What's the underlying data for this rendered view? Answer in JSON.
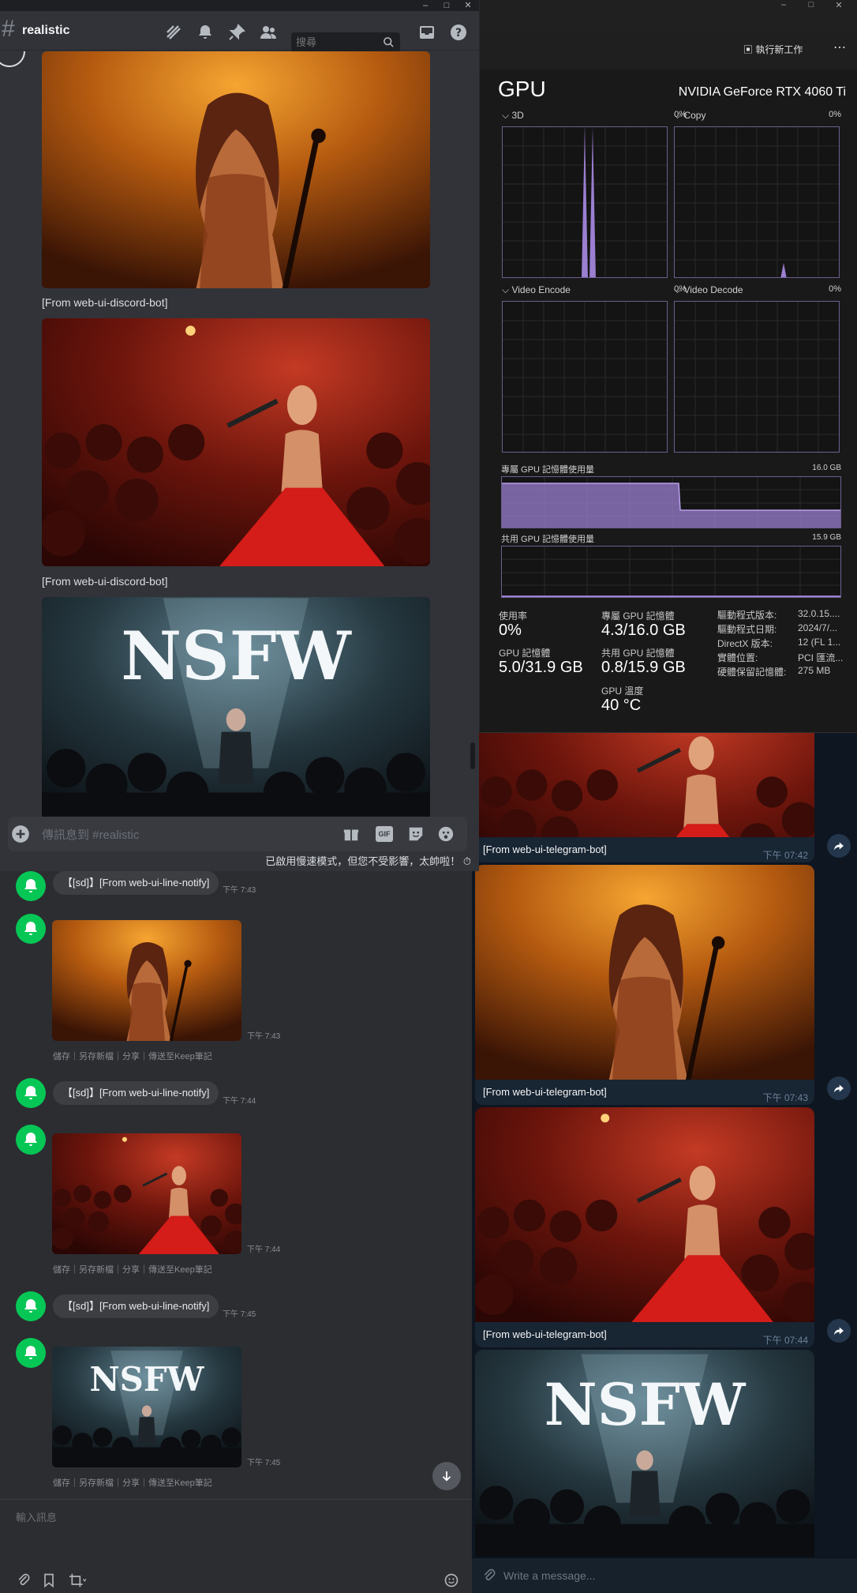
{
  "discord": {
    "channel": "realistic",
    "search_placeholder": "搜尋",
    "captions": [
      "[From web-ui-discord-bot]",
      "[From web-ui-discord-bot]"
    ],
    "composer_placeholder": "傳訊息到 #realistic",
    "gif_label": "GIF",
    "slowmode_notice": "已啟用慢速模式，但您不受影響，太帥啦！",
    "stage_text": "NSFW"
  },
  "taskmgr": {
    "run_task_label": "執行新工作",
    "heading": "GPU",
    "gpu_name": "NVIDIA GeForce RTX 4060 Ti",
    "graphs": [
      {
        "label": "3D",
        "pct": "0%"
      },
      {
        "label": "Copy",
        "pct": "0%"
      },
      {
        "label": "Video Encode",
        "pct": "0%"
      },
      {
        "label": "Video Decode",
        "pct": "0%"
      }
    ],
    "dedicated_label": "專屬 GPU 記憶體使用量",
    "dedicated_max": "16.0 GB",
    "shared_label": "共用 GPU 記憶體使用量",
    "shared_max": "15.9 GB",
    "stats": {
      "util_label": "使用率",
      "util_value": "0%",
      "ded_label": "專屬 GPU 記憶體",
      "ded_value": "4.3/16.0 GB",
      "gpumem_label": "GPU 記憶體",
      "gpumem_value": "5.0/31.9 GB",
      "shared_label": "共用 GPU 記憶體",
      "shared_value": "0.8/15.9 GB",
      "temp_label": "GPU 溫度",
      "temp_value": "40 °C"
    },
    "details": [
      {
        "k": "驅動程式版本:",
        "v": "32.0.15...."
      },
      {
        "k": "驅動程式日期:",
        "v": "2024/7/..."
      },
      {
        "k": "DirectX 版本:",
        "v": "12 (FL 1..."
      },
      {
        "k": "實體位置:",
        "v": "PCI 匯流..."
      },
      {
        "k": "硬體保留記憶體:",
        "v": "275 MB"
      }
    ]
  },
  "line": {
    "notify_text": "【[sd]】[From web-ui-line-notify]",
    "times": [
      "下午 7:43",
      "下午 7:43",
      "下午 7:44",
      "下午 7:44",
      "下午 7:45",
      "下午 7:45"
    ],
    "actions": "儲存｜另存新檔｜分享｜傳送至Keep筆記",
    "input_placeholder": "輸入訊息"
  },
  "telegram": {
    "captions": [
      "[From web-ui-telegram-bot]",
      "[From web-ui-telegram-bot]",
      "[From web-ui-telegram-bot]"
    ],
    "times": [
      "下午 07:42",
      "下午 07:43",
      "下午 07:44"
    ],
    "input_placeholder": "Write a message..."
  },
  "colors": {
    "discord_bg": "#313338",
    "line_green": "#06c755",
    "telegram_bg": "#0e1621",
    "graph_purple": "#9b7fd1"
  }
}
